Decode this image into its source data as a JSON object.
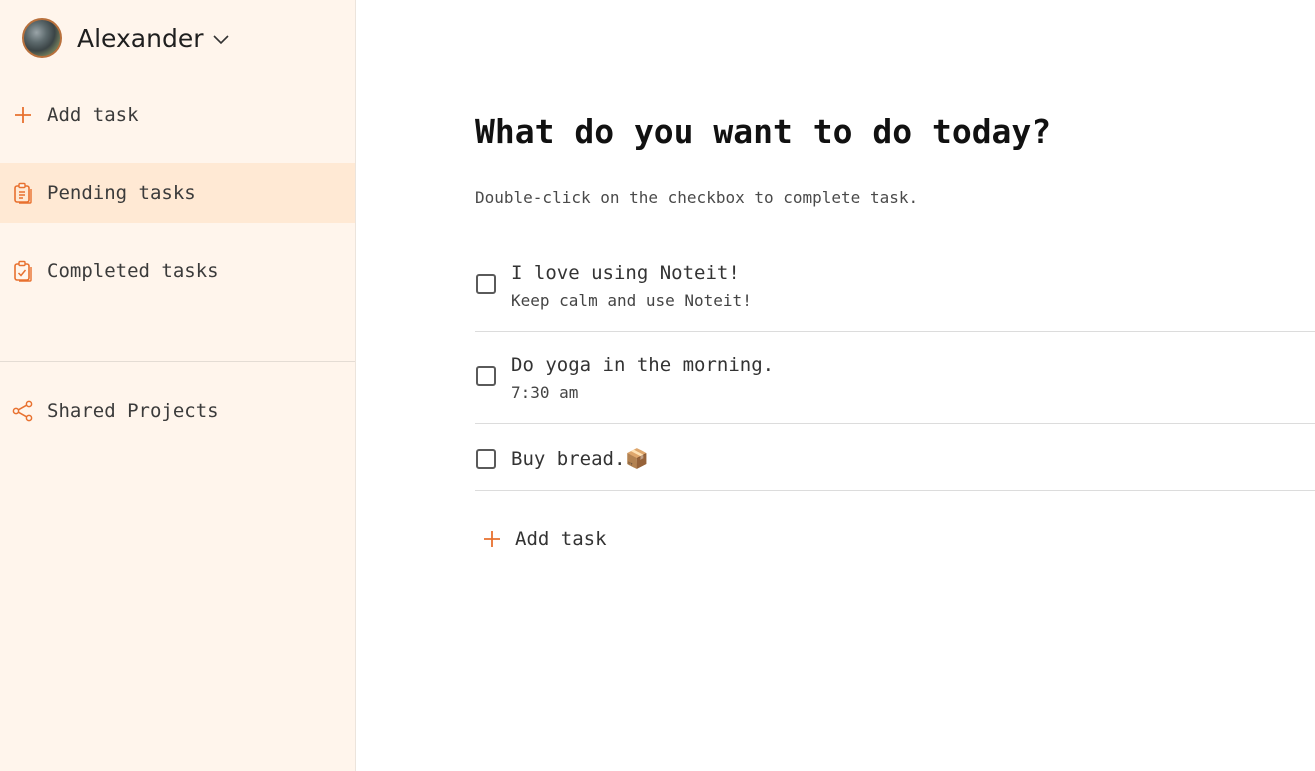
{
  "user": {
    "name": "Alexander"
  },
  "sidebar": {
    "items": [
      {
        "label": "Add task",
        "icon": "plus-icon"
      },
      {
        "label": "Pending tasks",
        "icon": "clipboard-list-icon",
        "active": true
      },
      {
        "label": "Completed tasks",
        "icon": "clipboard-check-icon"
      },
      {
        "label": "Shared Projects",
        "icon": "share-icon"
      }
    ]
  },
  "main": {
    "heading": "What do you want to do today?",
    "hint": "Double-click on the checkbox to complete task.",
    "tasks": [
      {
        "title": "I love using Noteit!",
        "description": "Keep calm and use Noteit!",
        "checked": false
      },
      {
        "title": "Do yoga in the morning.",
        "description": "7:30 am",
        "checked": false
      },
      {
        "title": "Buy bread.📦",
        "description": "",
        "checked": false
      }
    ],
    "add_task_label": "Add task"
  },
  "colors": {
    "accent": "#e8712f",
    "sidebar_bg": "#fff5ec",
    "active_bg": "#ffe9d4"
  }
}
